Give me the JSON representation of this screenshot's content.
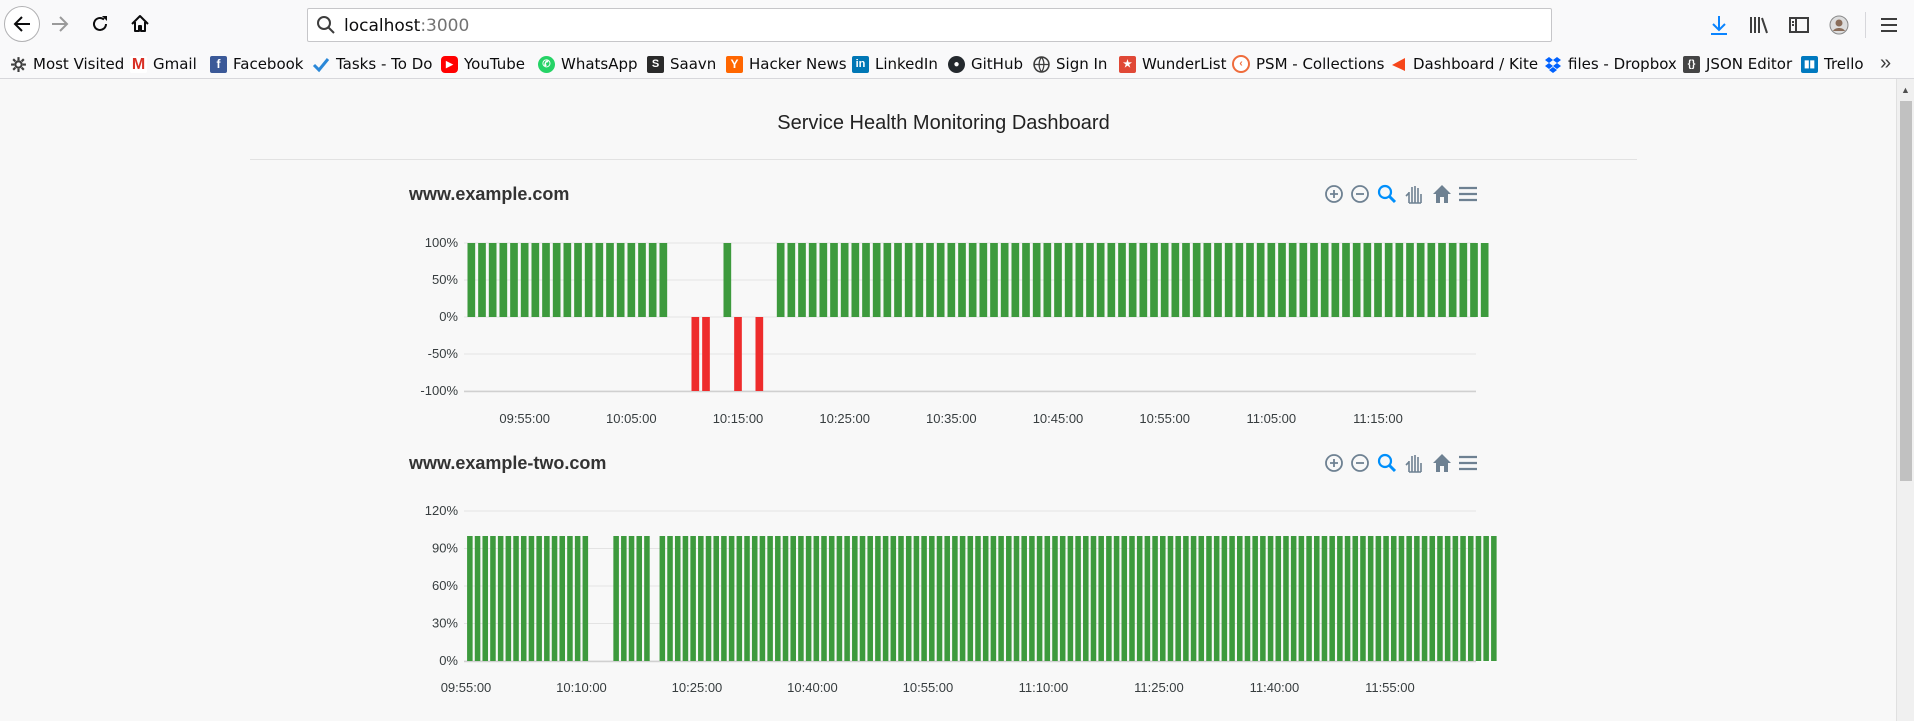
{
  "browser": {
    "url_host": "localhost",
    "url_port": ":3000",
    "bookmarks": [
      {
        "label": "Most Visited",
        "icon": "gear-icon"
      },
      {
        "label": "Gmail",
        "icon": "gmail-icon",
        "color": "#d93025"
      },
      {
        "label": "Facebook",
        "icon": "facebook-icon",
        "color": "#3b5998"
      },
      {
        "label": "Tasks - To Do",
        "icon": "check-icon",
        "color": "#2b88d8"
      },
      {
        "label": "YouTube",
        "icon": "youtube-icon",
        "color": "#ff0000"
      },
      {
        "label": "WhatsApp",
        "icon": "whatsapp-icon",
        "color": "#25d366"
      },
      {
        "label": "Saavn",
        "icon": "saavn-icon",
        "color": "#2a2a2a"
      },
      {
        "label": "Hacker News",
        "icon": "hackernews-icon",
        "color": "#ff6600"
      },
      {
        "label": "LinkedIn",
        "icon": "linkedin-icon",
        "color": "#0077b5"
      },
      {
        "label": "GitHub",
        "icon": "github-icon",
        "color": "#24292e"
      },
      {
        "label": "Sign In",
        "icon": "globe-icon",
        "color": "#3d3d3d"
      },
      {
        "label": "WunderList",
        "icon": "wunderlist-icon",
        "color": "#e04836"
      },
      {
        "label": "PSM - Collections",
        "icon": "psm-icon",
        "color": "#ef6c3c"
      },
      {
        "label": "Dashboard / Kite",
        "icon": "kite-icon",
        "color": "#f6461a"
      },
      {
        "label": "files - Dropbox",
        "icon": "dropbox-icon",
        "color": "#0061fe"
      },
      {
        "label": "JSON Editor",
        "icon": "json-icon",
        "color": "#444444"
      },
      {
        "label": "Trello",
        "icon": "trello-icon",
        "color": "#0079bf"
      }
    ]
  },
  "page": {
    "title": "Service Health Monitoring Dashboard"
  },
  "colors": {
    "up": "#3d9a3d",
    "down": "#ee2c2c",
    "grid": "#e3e3e3",
    "toolbar_icon": "#6e8192",
    "zoom_active": "#008ffb"
  },
  "chart_data": [
    {
      "type": "bar",
      "title": "www.example.com",
      "xlabel": "",
      "ylabel": "",
      "ylim": [
        -100,
        100
      ],
      "yticks": [
        "100%",
        "50%",
        "0%",
        "-50%",
        "-100%"
      ],
      "ytick_values": [
        100,
        50,
        0,
        -50,
        -100
      ],
      "xticks": [
        "09:55:00",
        "10:05:00",
        "10:15:00",
        "10:25:00",
        "10:35:00",
        "10:45:00",
        "10:55:00",
        "11:05:00",
        "11:15:00"
      ],
      "xtick_minutes": [
        595,
        605,
        615,
        625,
        635,
        645,
        655,
        665,
        675
      ],
      "x_start_minute": 589.5,
      "x_end_minute": 685.5,
      "interval_minutes": 1,
      "segments": [
        {
          "count": 19,
          "value": 100
        },
        {
          "count": 2,
          "value": 0
        },
        {
          "count": 2,
          "value": -100
        },
        {
          "count": 1,
          "value": 0
        },
        {
          "count": 1,
          "value": 100
        },
        {
          "count": 1,
          "value": -100
        },
        {
          "count": 1,
          "value": 0
        },
        {
          "count": 1,
          "value": -100
        },
        {
          "count": 1,
          "value": 0
        },
        {
          "count": 67,
          "value": 100
        }
      ],
      "grid": true,
      "legend": "none"
    },
    {
      "type": "bar",
      "title": "www.example-two.com",
      "xlabel": "",
      "ylabel": "",
      "ylim": [
        0,
        120
      ],
      "yticks": [
        "120%",
        "90%",
        "60%",
        "30%",
        "0%"
      ],
      "ytick_values": [
        120,
        90,
        60,
        30,
        0
      ],
      "xticks": [
        "09:55:00",
        "10:10:00",
        "10:25:00",
        "10:40:00",
        "10:55:00",
        "11:10:00",
        "11:25:00",
        "11:40:00",
        "11:55:00"
      ],
      "xtick_minutes": [
        595,
        610,
        625,
        640,
        655,
        670,
        685,
        700,
        715
      ],
      "x_start_minute": 595,
      "x_end_minute": 728,
      "interval_minutes": 1,
      "segments": [
        {
          "count": 16,
          "value": 100
        },
        {
          "count": 3,
          "value": 0
        },
        {
          "count": 5,
          "value": 100
        },
        {
          "count": 1,
          "value": 0
        },
        {
          "count": 109,
          "value": 100
        }
      ],
      "grid": true,
      "legend": "none"
    }
  ]
}
